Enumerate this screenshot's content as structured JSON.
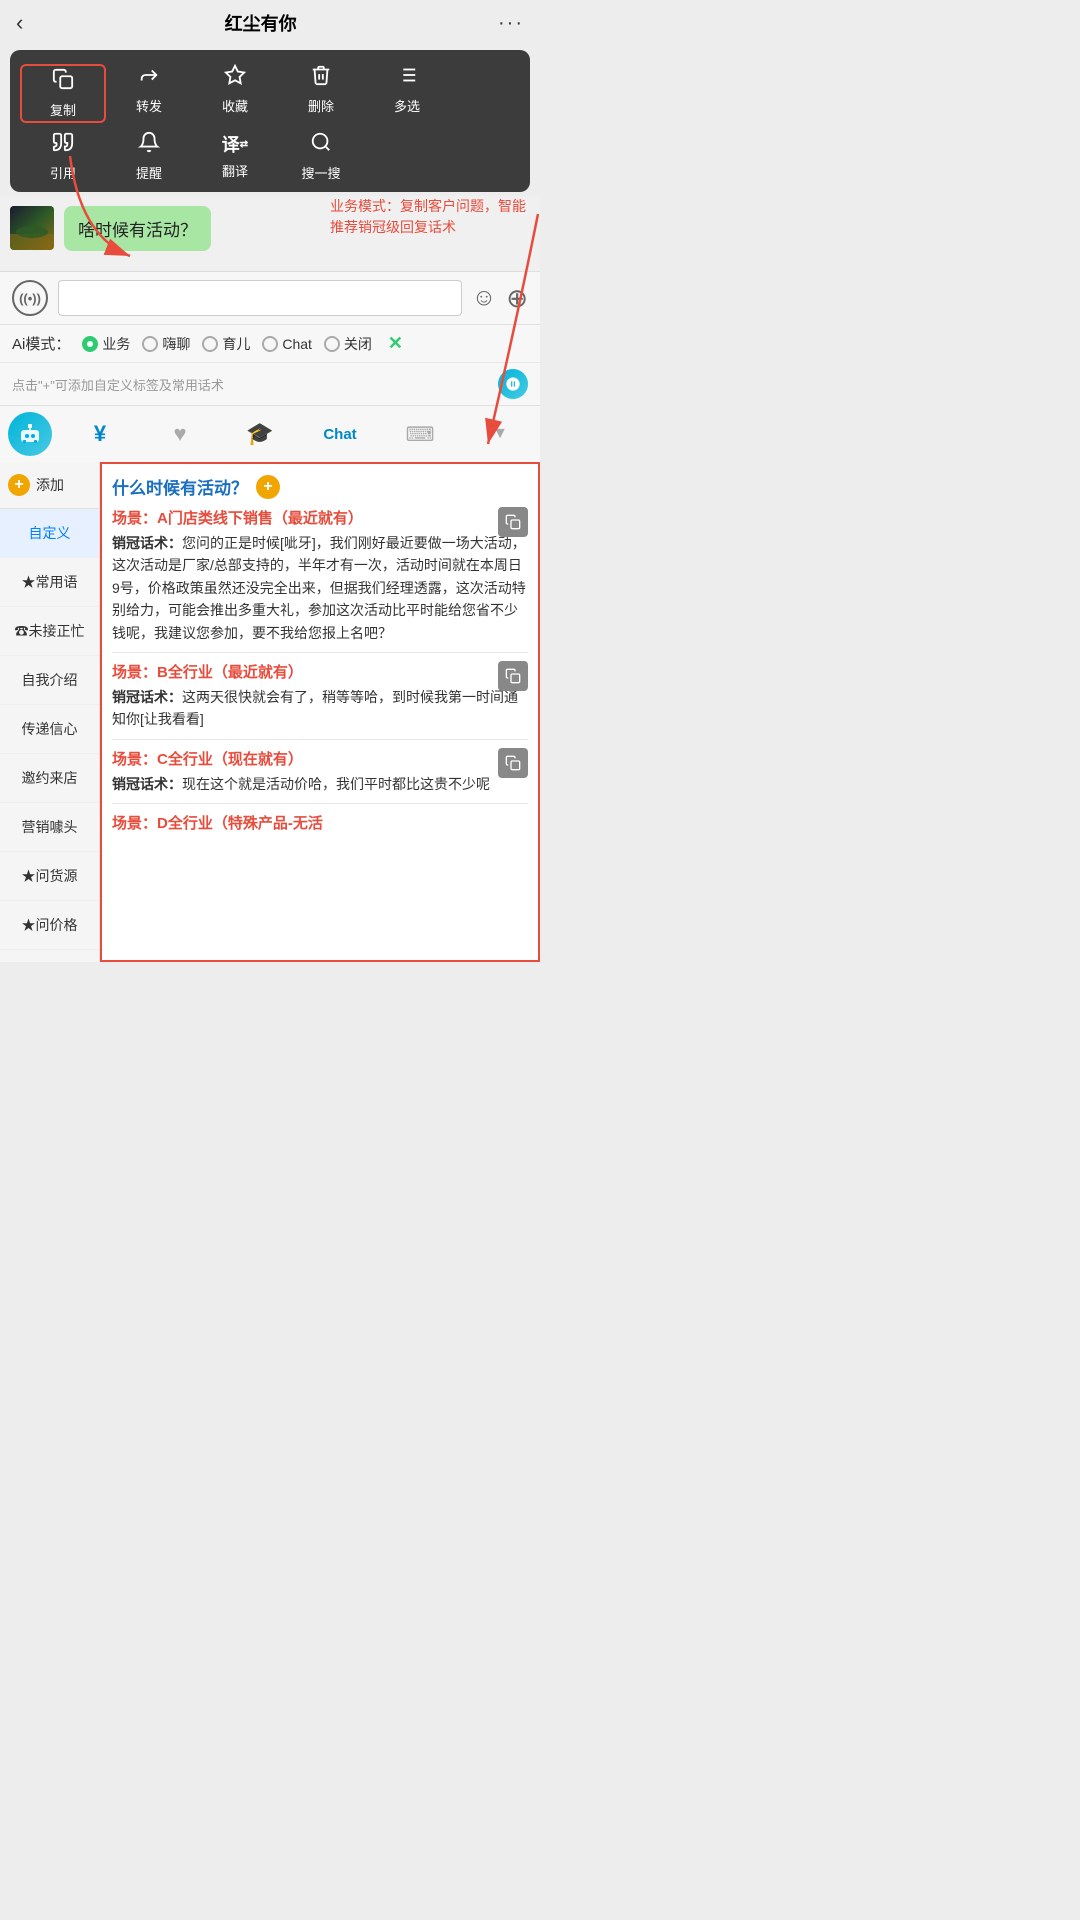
{
  "header": {
    "title": "红尘有你",
    "back_label": "‹",
    "more_label": "···"
  },
  "context_menu": {
    "row1": [
      {
        "icon": "📄",
        "label": "复制",
        "selected": true
      },
      {
        "icon": "↪",
        "label": "转发",
        "selected": false
      },
      {
        "icon": "⬡",
        "label": "收藏",
        "selected": false
      },
      {
        "icon": "🗑",
        "label": "删除",
        "selected": false
      },
      {
        "icon": "☰",
        "label": "多选",
        "selected": false
      }
    ],
    "row2": [
      {
        "icon": "❝",
        "label": "引用",
        "selected": false
      },
      {
        "icon": "🔔",
        "label": "提醒",
        "selected": false
      },
      {
        "icon": "译",
        "label": "翻译",
        "selected": false
      },
      {
        "icon": "⌖",
        "label": "搜一搜",
        "selected": false
      }
    ]
  },
  "chat": {
    "bubble_text": "啥时候有活动？"
  },
  "annotation": {
    "text": "业务模式：复制客户问题，智能推荐销冠级回复话术"
  },
  "input": {
    "placeholder": "",
    "voice_icon": "((•))",
    "emoji_icon": "☺",
    "plus_icon": "+"
  },
  "ai_mode": {
    "label": "Ai模式：",
    "options": [
      {
        "value": "业务",
        "active": true
      },
      {
        "value": "嗨聊",
        "active": false
      },
      {
        "value": "育儿",
        "active": false
      },
      {
        "value": "Chat",
        "active": false
      },
      {
        "value": "关闭",
        "active": false
      }
    ],
    "close_label": "✕"
  },
  "tags_hint": {
    "text": "点击\"+\"可添加自定义标签及常用话术"
  },
  "toolbar": {
    "items": [
      {
        "icon": "🤖",
        "label": "chat",
        "type": "robot"
      },
      {
        "icon": "¥",
        "label": "",
        "type": "icon"
      },
      {
        "icon": "♥",
        "label": "",
        "type": "icon"
      },
      {
        "icon": "🎓",
        "label": "",
        "type": "icon"
      },
      {
        "icon": "Chat",
        "label": "",
        "type": "text"
      },
      {
        "icon": "⌨",
        "label": "",
        "type": "icon"
      },
      {
        "icon": "▼",
        "label": "",
        "type": "icon"
      }
    ]
  },
  "sidebar": {
    "add_label": "添加",
    "items": [
      {
        "label": "自定义",
        "active": true
      },
      {
        "label": "★常用语",
        "star": true
      },
      {
        "label": "☎未接正忙",
        "phone": true
      },
      {
        "label": "自我介绍"
      },
      {
        "label": "传递信心"
      },
      {
        "label": "邀约来店"
      },
      {
        "label": "营销噱头"
      },
      {
        "label": "★问货源",
        "star": true
      },
      {
        "label": "★问价格",
        "star": true
      }
    ]
  },
  "right_panel": {
    "question": "什么时候有活动？",
    "scenarios": [
      {
        "title": "场景：A门店类线下销售（最近就有）",
        "content": "销冠话术：您问的正是时候[呲牙]，我们刚好最近要做一场大活动，这次活动是厂家/总部支持的，半年才有一次，活动时间就在本周日9号，价格政策虽然还没完全出来，但据我们经理透露，这次活动特别给力，可能会推出多重大礼，参加这次活动比平时能给您省不少钱呢，我建议您参加，要不我给您报上名吧？"
      },
      {
        "title": "场景：B全行业（最近就有）",
        "content": "销冠话术：这两天很快就会有了，稍等等哈，到时候我第一时间通知你[让我看看]"
      },
      {
        "title": "场景：C全行业（现在就有）",
        "content": "销冠话术：现在这个就是活动价哈，我们平时都比这贵不少呢"
      },
      {
        "title": "场景：D全行业（特殊产品-无活",
        "content": ""
      }
    ]
  }
}
